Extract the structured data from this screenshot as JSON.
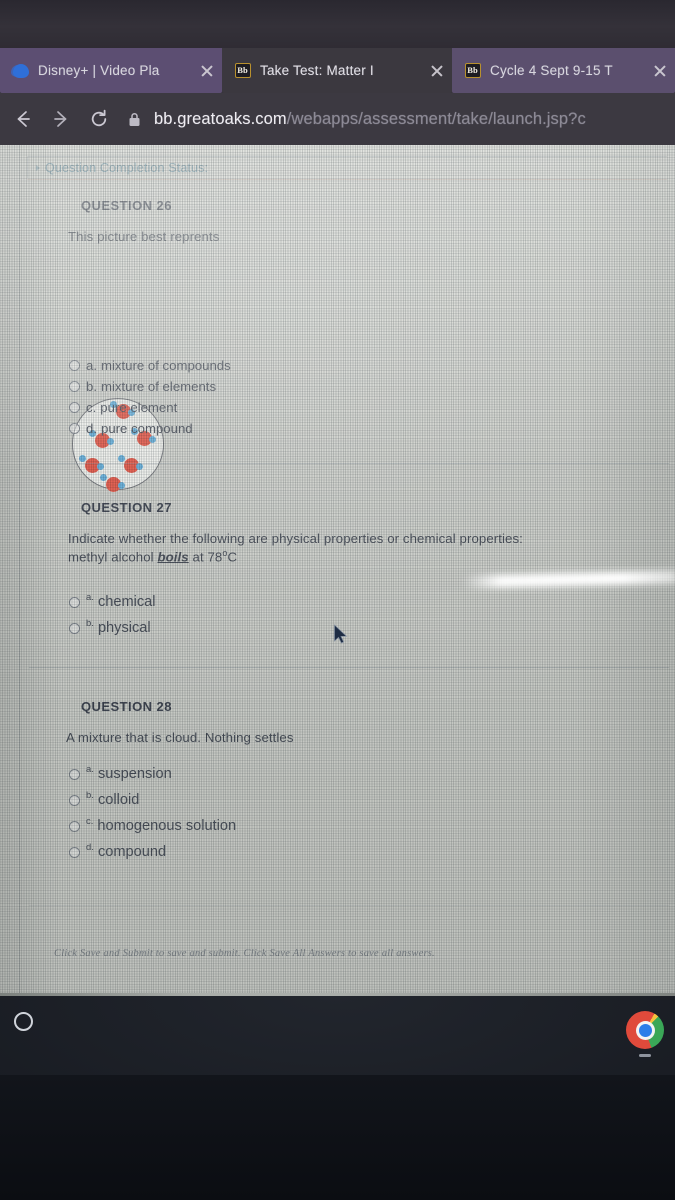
{
  "browser": {
    "tabs": [
      {
        "title": "Disney+ | Video Pla",
        "favicon": "disney-icon",
        "active": true
      },
      {
        "title": "Take Test: Matter I",
        "favicon": "blackboard-icon",
        "active": false
      },
      {
        "title": "Cycle 4 Sept 9-15 T",
        "favicon": "blackboard-icon",
        "active": false
      }
    ],
    "nav": {
      "back_label": "←",
      "forward_label": "→",
      "reload_label": "reload-icon",
      "lock_label": "lock-icon"
    },
    "omnibox": {
      "host": "bb.greatoaks.com",
      "path": "/webapps/assessment/take/launch.jsp?c"
    }
  },
  "page": {
    "completion_status": {
      "label": "Question Completion Status:",
      "caret": "expand-caret-icon"
    },
    "questions": [
      {
        "heading": "QUESTION 26",
        "prompt": "This picture best reprents",
        "has_image": true,
        "image_alt": "circle containing red-and-blue compound molecules",
        "options": [
          {
            "letter": "a.",
            "label": "mixture of compounds"
          },
          {
            "letter": "b.",
            "label": "mixture of elements"
          },
          {
            "letter": "c.",
            "label": "pure element"
          },
          {
            "letter": "d.",
            "label": "pure compound"
          }
        ]
      },
      {
        "heading": "QUESTION 27",
        "prompt_pre": "Indicate whether the following are physical properties or chemical properties:",
        "prompt_line2_pre": "methyl alcohol ",
        "prompt_emph": "boils",
        "prompt_line2_post": " at 78",
        "prompt_sup": "o",
        "prompt_line2_end": "C",
        "options": [
          {
            "letter": "a.",
            "label": "chemical"
          },
          {
            "letter": "b.",
            "label": "physical"
          }
        ]
      },
      {
        "heading": "QUESTION 28",
        "prompt": "A mixture that is cloud.  Nothing settles",
        "options": [
          {
            "letter": "a.",
            "label": "suspension"
          },
          {
            "letter": "b.",
            "label": "colloid"
          },
          {
            "letter": "c.",
            "label": "homogenous solution"
          },
          {
            "letter": "d.",
            "label": "compound"
          }
        ]
      }
    ],
    "footer_note": "Click Save and Submit to save and submit. Click Save All Answers to save all answers."
  },
  "shelf": {
    "launcher_label": "launcher-icon",
    "apps": [
      {
        "name": "chrome-icon"
      }
    ]
  },
  "colors": {
    "tab_active": "#5c4e72",
    "tab_inactive": "#3b383f",
    "chrome_bg": "#35323a",
    "link_teal": "#3d6f85",
    "molecule_red": "#e2402f",
    "molecule_blue": "#4fa5d8",
    "shelf_bg": "#161a22"
  }
}
